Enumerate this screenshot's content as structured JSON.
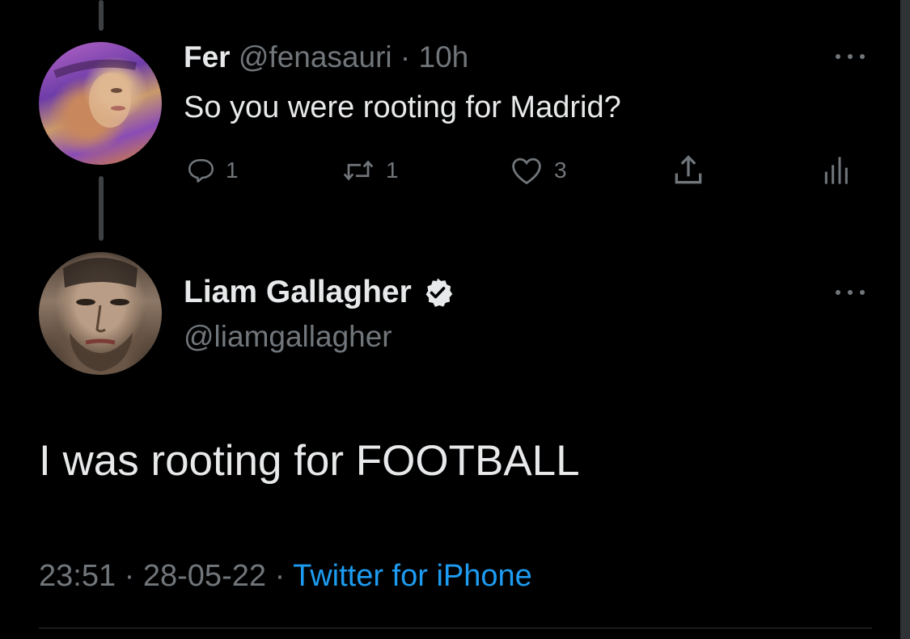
{
  "reply": {
    "name": "Fer",
    "handle": "@fenasauri",
    "separator": "·",
    "time": "10h",
    "text": "So you were rooting for Madrid?",
    "actions": {
      "reply_count": "1",
      "retweet_count": "1",
      "like_count": "3"
    }
  },
  "main_tweet": {
    "name": "Liam Gallagher",
    "handle": "@liamgallagher",
    "text": "I was rooting for FOOTBALL",
    "time": "23:51",
    "separator": "·",
    "date": "28-05-22",
    "source": "Twitter for iPhone"
  },
  "colors": {
    "background": "#000000",
    "primary_text": "#e7e9ea",
    "muted_text": "#71767b",
    "link": "#1d9bf0"
  }
}
